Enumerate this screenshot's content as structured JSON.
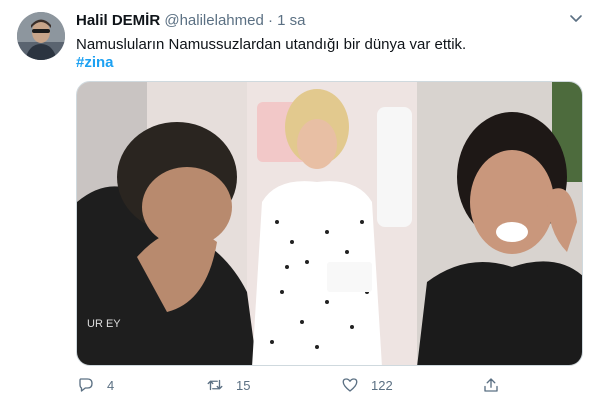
{
  "tweet": {
    "author_name": "Halil DEMİR",
    "handle": "@halilelahmed",
    "separator": "·",
    "time": "1 sa",
    "text": "Namusluların Namussuzlardan utandığı bir dünya var ettik.",
    "hashtag": "#zina"
  },
  "actions": {
    "reply_count": "4",
    "retweet_count": "15",
    "like_count": "122"
  },
  "icons": [
    "chevron-down-icon",
    "reply-icon",
    "retweet-icon",
    "like-icon",
    "share-icon"
  ],
  "colors": {
    "link": "#1da1f2",
    "muted": "#5b7083",
    "text": "#0f1419"
  }
}
